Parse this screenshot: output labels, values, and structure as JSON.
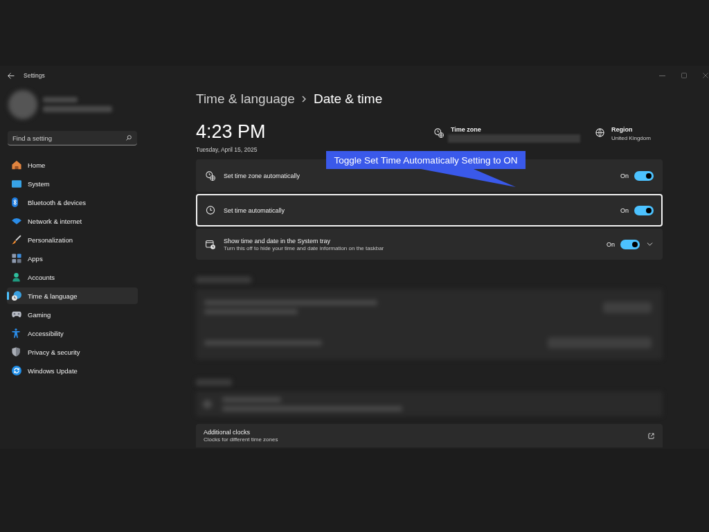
{
  "window": {
    "title": "Settings"
  },
  "sidebar": {
    "search": {
      "placeholder": "Find a setting"
    },
    "items": [
      {
        "label": "Home",
        "selected": false
      },
      {
        "label": "System",
        "selected": false
      },
      {
        "label": "Bluetooth & devices",
        "selected": false
      },
      {
        "label": "Network & internet",
        "selected": false
      },
      {
        "label": "Personalization",
        "selected": false
      },
      {
        "label": "Apps",
        "selected": false
      },
      {
        "label": "Accounts",
        "selected": false
      },
      {
        "label": "Time & language",
        "selected": true
      },
      {
        "label": "Gaming",
        "selected": false
      },
      {
        "label": "Accessibility",
        "selected": false
      },
      {
        "label": "Privacy & security",
        "selected": false
      },
      {
        "label": "Windows Update",
        "selected": false
      }
    ]
  },
  "breadcrumb": {
    "parent": "Time & language",
    "current": "Date & time"
  },
  "clock": {
    "time": "4:23 PM",
    "date": "Tuesday, April 15, 2025"
  },
  "time_zone": {
    "label": "Time zone"
  },
  "region": {
    "label": "Region",
    "value": "United Kingdom"
  },
  "settings": [
    {
      "label": "Set time zone automatically",
      "status": "On",
      "on": true,
      "highlighted": false,
      "expandable": false
    },
    {
      "label": "Set time automatically",
      "status": "On",
      "on": true,
      "highlighted": true,
      "expandable": false
    },
    {
      "label": "Show time and date in the System tray",
      "description": "Turn this off to hide your time and date information on the taskbar",
      "status": "On",
      "on": true,
      "highlighted": false,
      "expandable": true
    }
  ],
  "callout": {
    "text": "Toggle Set Time Automatically Setting to ON"
  },
  "additional_clocks": {
    "title": "Additional clocks",
    "description": "Clocks for different time zones"
  }
}
